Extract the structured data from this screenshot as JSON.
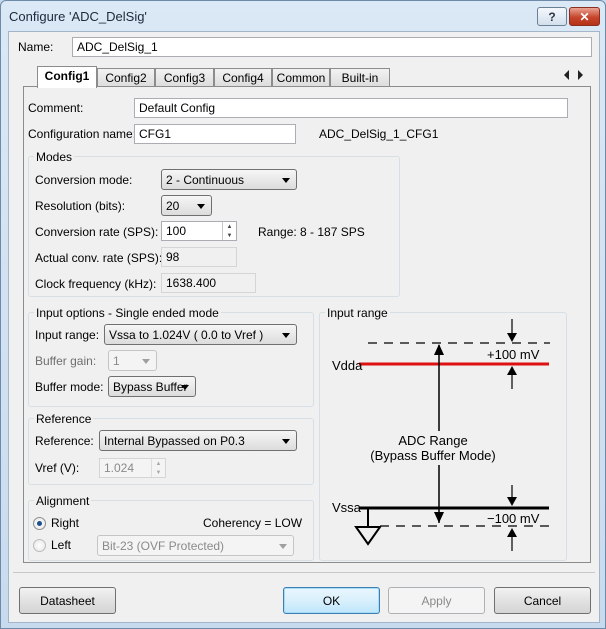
{
  "window": {
    "title": "Configure 'ADC_DelSig'"
  },
  "name": {
    "label": "Name:",
    "value": "ADC_DelSig_1"
  },
  "tabs": [
    {
      "label": "Config1",
      "active": true
    },
    {
      "label": "Config2"
    },
    {
      "label": "Config3"
    },
    {
      "label": "Config4"
    },
    {
      "label": "Common"
    },
    {
      "label": "Built-in"
    }
  ],
  "config": {
    "comment_label": "Comment:",
    "comment_value": "Default Config",
    "config_name_label": "Configuration name:",
    "config_name_value": "CFG1",
    "full_name": "ADC_DelSig_1_CFG1"
  },
  "modes": {
    "title": "Modes",
    "conversion_mode_label": "Conversion mode:",
    "conversion_mode_value": "2 - Continuous",
    "resolution_label": "Resolution (bits):",
    "resolution_value": "20",
    "conversion_rate_label": "Conversion rate (SPS):",
    "conversion_rate_value": "100",
    "range_text": "Range: 8 - 187 SPS",
    "actual_rate_label": "Actual conv. rate (SPS):",
    "actual_rate_value": "98",
    "clock_label": "Clock frequency (kHz):",
    "clock_value": "1638.400"
  },
  "input_options": {
    "title": "Input options - Single ended mode",
    "input_range_label": "Input range:",
    "input_range_value": "Vssa to 1.024V ( 0.0 to Vref )",
    "buffer_gain_label": "Buffer gain:",
    "buffer_gain_value": "1",
    "buffer_mode_label": "Buffer mode:",
    "buffer_mode_value": "Bypass Buffer"
  },
  "reference": {
    "title": "Reference",
    "reference_label": "Reference:",
    "reference_value": "Internal Bypassed on P0.3",
    "vref_label": "Vref (V):",
    "vref_value": "1.024"
  },
  "alignment": {
    "title": "Alignment",
    "right_label": "Right",
    "left_label": "Left",
    "coherency": "Coherency = LOW",
    "left_option_value": "Bit-23 (OVF Protected)"
  },
  "input_range_diagram": {
    "title": "Input range",
    "vdda": "Vdda",
    "vssa": "Vssa",
    "plus_mv": "+100 mV",
    "minus_mv": "−100 mV",
    "adc_range": "ADC Range",
    "mode_text": "(Bypass Buffer Mode)"
  },
  "buttons": {
    "datasheet": "Datasheet",
    "ok": "OK",
    "apply": "Apply",
    "cancel": "Cancel",
    "help": "?",
    "close": "✕"
  },
  "colors": {
    "vdda_line": "#dd1111",
    "accent": "#3c7fb1"
  }
}
